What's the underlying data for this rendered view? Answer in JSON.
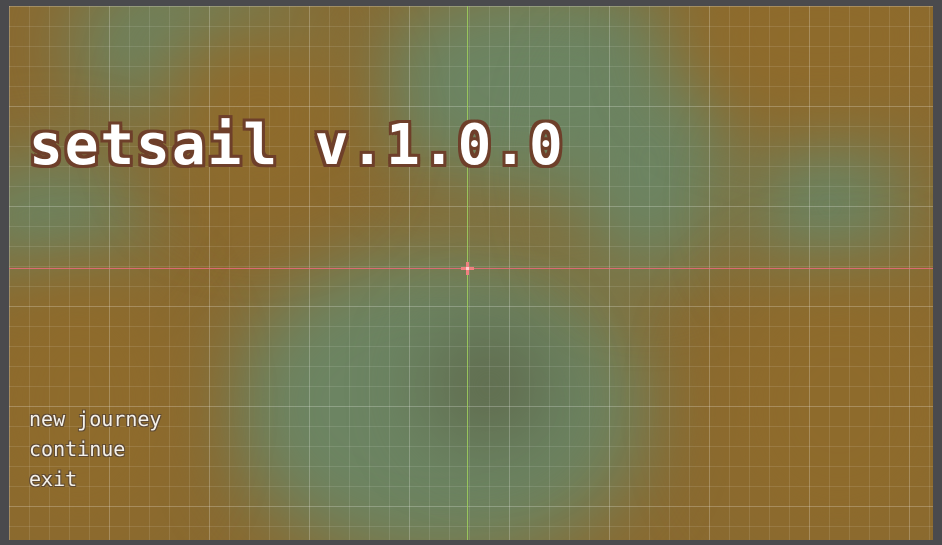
{
  "game": {
    "title": "setsail v.1.0.0",
    "menu": [
      {
        "id": "new-journey",
        "label": "new journey"
      },
      {
        "id": "continue",
        "label": "continue"
      },
      {
        "id": "exit",
        "label": "exit"
      }
    ]
  },
  "colors": {
    "editor_frame": "#4a4a4d",
    "background_ochre": "#8e6b2c",
    "background_green": "#6c8462",
    "title_fill": "#ffffff",
    "title_outline": "#6e3f2a",
    "axis_x": "#e66a78",
    "axis_y": "#9ccc5c"
  },
  "icons": {
    "origin": "crosshair-origin-icon"
  }
}
